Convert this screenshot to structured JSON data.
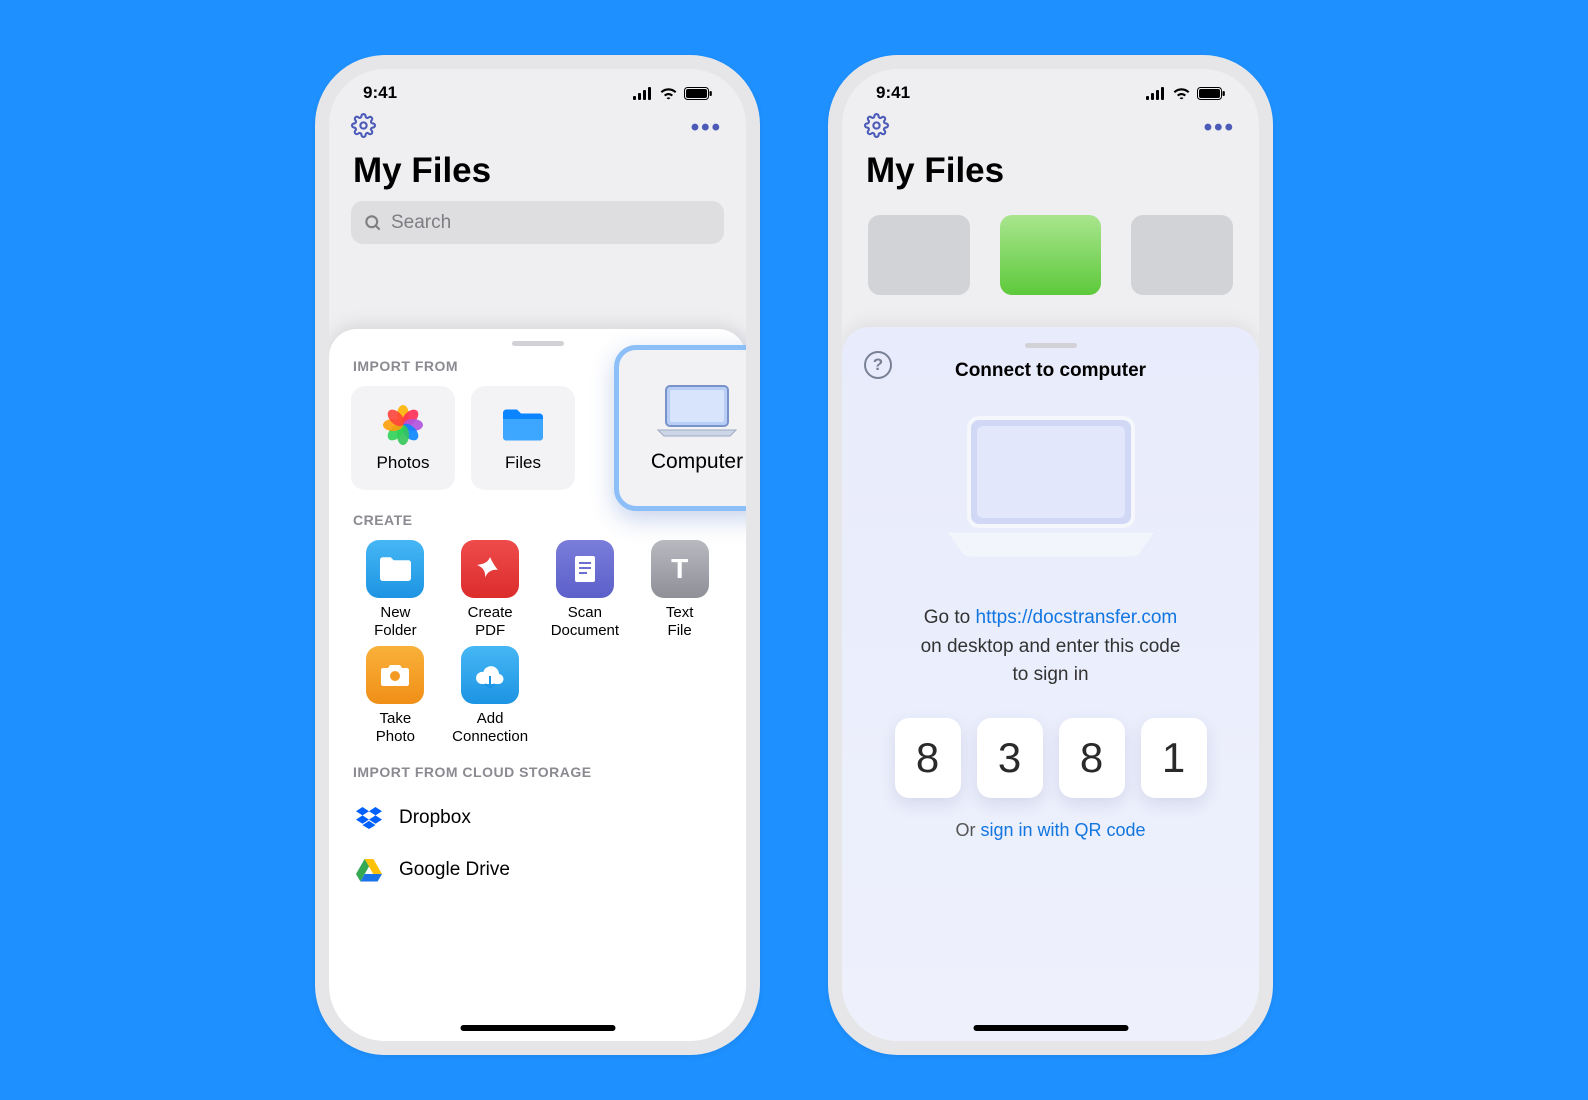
{
  "status": {
    "time": "9:41"
  },
  "header": {
    "title": "My Files"
  },
  "search": {
    "placeholder": "Search"
  },
  "sheet1": {
    "section_import": "IMPORT FROM",
    "section_create": "CREATE",
    "section_cloud": "IMPORT FROM CLOUD STORAGE",
    "import_items": [
      {
        "label": "Photos"
      },
      {
        "label": "Files"
      },
      {
        "label": "Computer"
      }
    ],
    "create_items": [
      {
        "label": "New\nFolder"
      },
      {
        "label": "Create\nPDF"
      },
      {
        "label": "Scan\nDocument"
      },
      {
        "label": "Text\nFile"
      },
      {
        "label": "Take\nPhoto"
      },
      {
        "label": "Add\nConnection"
      }
    ],
    "cloud_items": [
      {
        "label": "Dropbox"
      },
      {
        "label": "Google Drive"
      }
    ]
  },
  "sheet2": {
    "title": "Connect to computer",
    "instruction_prefix": "Go to ",
    "url": "https://docstransfer.com",
    "instruction_mid": "on desktop and enter this code",
    "instruction_suffix": "to sign in",
    "code": [
      "8",
      "3",
      "8",
      "1"
    ],
    "alt_prefix": "Or ",
    "alt_link": "sign in with QR code"
  }
}
